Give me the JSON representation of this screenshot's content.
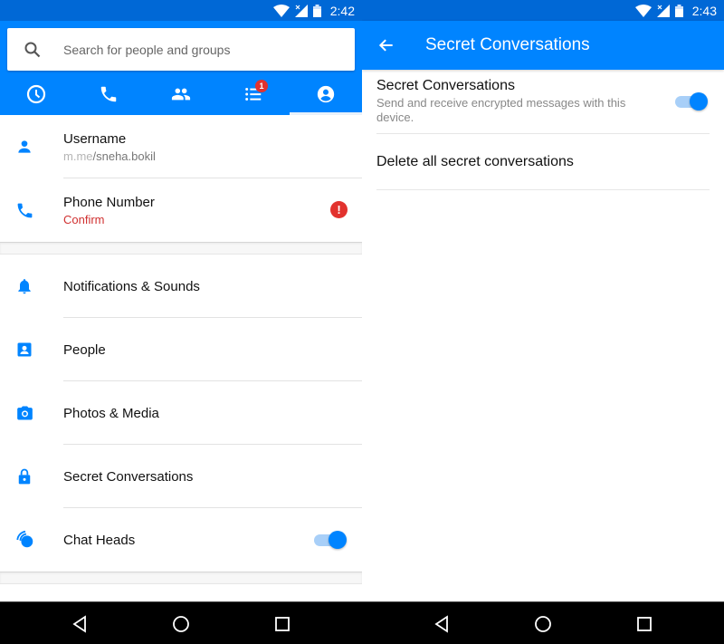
{
  "left": {
    "status": {
      "time": "2:42"
    },
    "search": {
      "placeholder": "Search for people and groups"
    },
    "tabs": [
      {
        "name": "recent",
        "icon": "clock-icon"
      },
      {
        "name": "calls",
        "icon": "phone-icon"
      },
      {
        "name": "groups",
        "icon": "people-icon"
      },
      {
        "name": "active",
        "icon": "list-icon",
        "badge": "1"
      },
      {
        "name": "profile",
        "icon": "account-circle-icon",
        "active": true
      }
    ],
    "account": {
      "username": {
        "title": "Username",
        "host": "m.me",
        "path": "/sneha.bokil"
      },
      "phone": {
        "title": "Phone Number",
        "subtitle": "Confirm",
        "alert": "!"
      }
    },
    "settings": [
      {
        "label": "Notifications & Sounds",
        "icon": "bell-icon"
      },
      {
        "label": "People",
        "icon": "contact-icon"
      },
      {
        "label": "Photos & Media",
        "icon": "camera-icon"
      },
      {
        "label": "Secret Conversations",
        "icon": "lock-icon"
      },
      {
        "label": "Chat Heads",
        "icon": "chat-heads-icon",
        "toggle": true
      }
    ]
  },
  "right": {
    "status": {
      "time": "2:43"
    },
    "appbar": {
      "title": "Secret Conversations"
    },
    "option": {
      "title": "Secret Conversations",
      "subtitle": "Send and receive encrypted messages with this device.",
      "enabled": true
    },
    "delete_label": "Delete all secret conversations"
  },
  "colors": {
    "brand": "#0084ff",
    "statusbar": "#0068d6",
    "alert": "#e2322e",
    "confirm_text": "#d03030"
  }
}
